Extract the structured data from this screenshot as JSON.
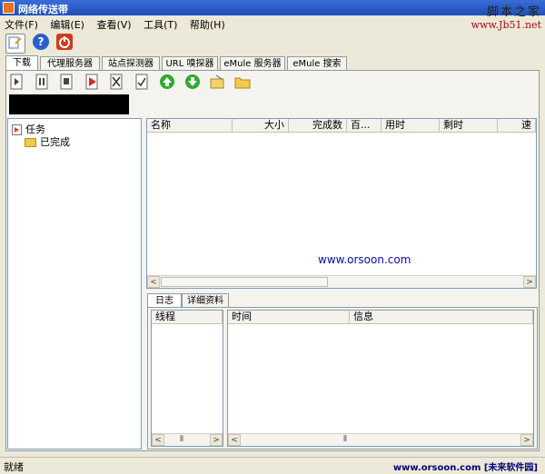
{
  "window": {
    "title": "网络传送带"
  },
  "watermark": {
    "line1": "脚本之家",
    "line2": "www.Jb51.net"
  },
  "menu": [
    "文件(F)",
    "编辑(E)",
    "查看(V)",
    "工具(T)",
    "帮助(H)"
  ],
  "toolbar1": [
    {
      "icon": "new-task-icon",
      "color": "#3a7bd5"
    },
    {
      "icon": "help-icon",
      "color": "#2a5fd0"
    },
    {
      "icon": "power-icon",
      "color": "#d23a1f"
    }
  ],
  "tabs": [
    "下载",
    "代理服务器",
    "站点探测器",
    "URL 嗅探器",
    "eMule 服务器",
    "eMule 搜索"
  ],
  "toolbar2": [
    "start-icon",
    "pause-icon",
    "stop-icon",
    "play-red-icon",
    "delete-icon",
    "check-icon",
    "move-up-icon",
    "move-down-icon",
    "open-icon",
    "folder-icon"
  ],
  "tree": {
    "root": "任务",
    "child": "已完成"
  },
  "columns": [
    "名称",
    "大小",
    "完成数",
    "百...",
    "用时",
    "剩时",
    "速"
  ],
  "watermark_url": "www.orsoon.com",
  "log_tabs": [
    "日志",
    "详细资料"
  ],
  "log_left_header": "线程",
  "log_right_headers": [
    "时间",
    "信息"
  ],
  "status": {
    "left": "就绪",
    "right": "www.orsoon.com [未来软件园]"
  },
  "scroll": {
    "left": "<",
    "right": ">",
    "grip": "⦀"
  }
}
